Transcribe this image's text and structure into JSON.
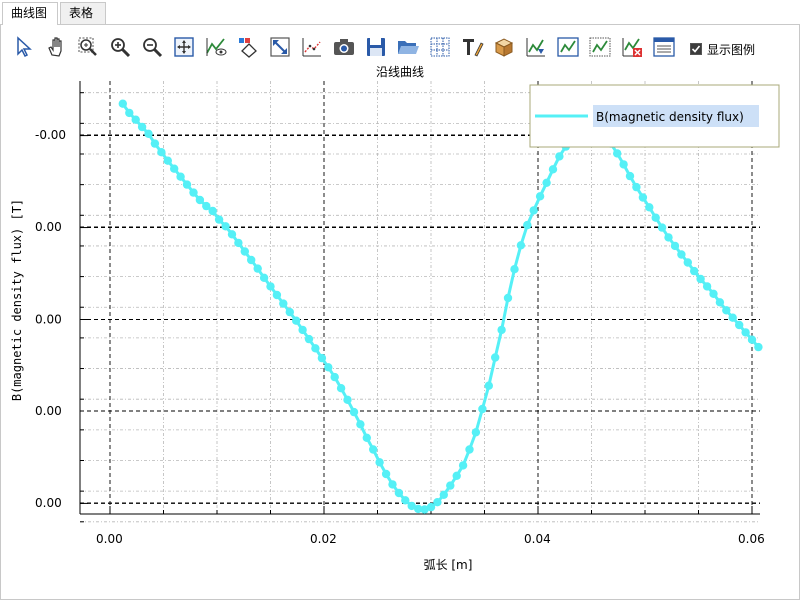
{
  "tabs": [
    {
      "label": "曲线图",
      "active": true
    },
    {
      "label": "表格",
      "active": false
    }
  ],
  "toolbar": {
    "icons": [
      "pointer-icon",
      "hand-pan-icon",
      "zoom-region-icon",
      "zoom-in-icon",
      "zoom-out-icon",
      "fit-view-icon",
      "curve-eye-icon",
      "diamond-select-icon",
      "resize-arrows-icon",
      "scatter-curve-icon",
      "camera-icon",
      "save-icon",
      "folder-open-icon",
      "grid-icon",
      "text-edit-icon",
      "cube-icon",
      "curve-export-icon",
      "curve-settings-icon",
      "curve-data-icon",
      "curve-delete-icon",
      "properties-panel-icon"
    ],
    "legend_checkbox_label": "显示图例",
    "legend_checked": true
  },
  "chart_data": {
    "type": "line",
    "title": "沿线曲线",
    "xlabel": "弧长 [m]",
    "ylabel": "B(magnetic density flux) [T]",
    "xlim": [
      -0.001,
      0.0625
    ],
    "ylim": [
      -0.0365,
      0.0395
    ],
    "x_ticks": [
      0.0,
      0.02,
      0.04,
      0.06
    ],
    "x_tick_labels": [
      "0.00",
      "0.02",
      "0.04",
      "0.06"
    ],
    "y_ticks": [
      -0.03,
      0.0,
      0.015,
      0.03
    ],
    "y_tick_labels": [
      "-0.00",
      "0.00",
      "0.00",
      "0.00",
      "0.00"
    ],
    "grid": true,
    "legend_position": "top-right",
    "colors": {
      "series": "#55f0f6",
      "plot_bg": "#ffffff",
      "legend_selection": "#cde0f7",
      "legend_border": "#a8a878"
    },
    "series": [
      {
        "name": "B(magnetic density flux)",
        "x": [
          0.0012,
          0.0018,
          0.0024,
          0.003,
          0.0036,
          0.0042,
          0.0048,
          0.0054,
          0.006,
          0.0066,
          0.0072,
          0.0078,
          0.0084,
          0.009,
          0.0096,
          0.0102,
          0.0108,
          0.0114,
          0.012,
          0.0126,
          0.0132,
          0.0138,
          0.0144,
          0.015,
          0.0156,
          0.0162,
          0.0168,
          0.0174,
          0.018,
          0.0186,
          0.0192,
          0.0198,
          0.0204,
          0.021,
          0.0216,
          0.0222,
          0.0228,
          0.0234,
          0.024,
          0.0246,
          0.0252,
          0.0258,
          0.0264,
          0.027,
          0.0276,
          0.0282,
          0.0288,
          0.0294,
          0.03,
          0.0306,
          0.0312,
          0.0318,
          0.0324,
          0.033,
          0.0336,
          0.0342,
          0.0348,
          0.0354,
          0.036,
          0.0366,
          0.0372,
          0.0378,
          0.0384,
          0.039,
          0.0396,
          0.0402,
          0.0408,
          0.0414,
          0.042,
          0.0426,
          0.0432,
          0.0438,
          0.0444,
          0.045,
          0.0456,
          0.0462,
          0.0468,
          0.0474,
          0.048,
          0.0486,
          0.0492,
          0.0498,
          0.0504,
          0.051,
          0.0516,
          0.0522,
          0.0528,
          0.0534,
          0.054,
          0.0546,
          0.0552,
          0.0558,
          0.0564,
          0.057,
          0.0576,
          0.0582,
          0.0588,
          0.0594,
          0.06,
          0.0606
        ],
        "y": [
          0.0352,
          0.0337,
          0.0326,
          0.0314,
          0.0303,
          0.0287,
          0.0273,
          0.0259,
          0.0246,
          0.0233,
          0.022,
          0.0207,
          0.0195,
          0.0185,
          0.0177,
          0.0163,
          0.0152,
          0.0139,
          0.0125,
          0.0111,
          0.0097,
          0.0083,
          0.0068,
          0.0054,
          0.004,
          0.0026,
          0.0012,
          -0.0002,
          -0.0017,
          -0.0032,
          -0.0047,
          -0.0063,
          -0.0078,
          -0.0094,
          -0.0112,
          -0.0131,
          -0.0151,
          -0.0171,
          -0.0193,
          -0.0212,
          -0.0233,
          -0.0252,
          -0.0269,
          -0.0283,
          -0.0295,
          -0.0304,
          -0.0309,
          -0.031,
          -0.0306,
          -0.0298,
          -0.0286,
          -0.0271,
          -0.0255,
          -0.0238,
          -0.0212,
          -0.0184,
          -0.0146,
          -0.0108,
          -0.0062,
          -0.0017,
          0.0035,
          0.0082,
          0.0121,
          0.0154,
          0.0178,
          0.0201,
          0.0223,
          0.0245,
          0.0266,
          0.0282,
          0.0289,
          0.0296,
          0.0302,
          0.0307,
          0.0304,
          0.0298,
          0.0287,
          0.0271,
          0.0253,
          0.0234,
          0.0216,
          0.0199,
          0.0183,
          0.0166,
          0.015,
          0.0134,
          0.012,
          0.0106,
          0.0093,
          0.0079,
          0.0066,
          0.0054,
          0.0042,
          0.0028,
          0.0015,
          0.0003,
          -0.0009,
          -0.0021,
          -0.0033,
          -0.0045
        ]
      }
    ]
  }
}
